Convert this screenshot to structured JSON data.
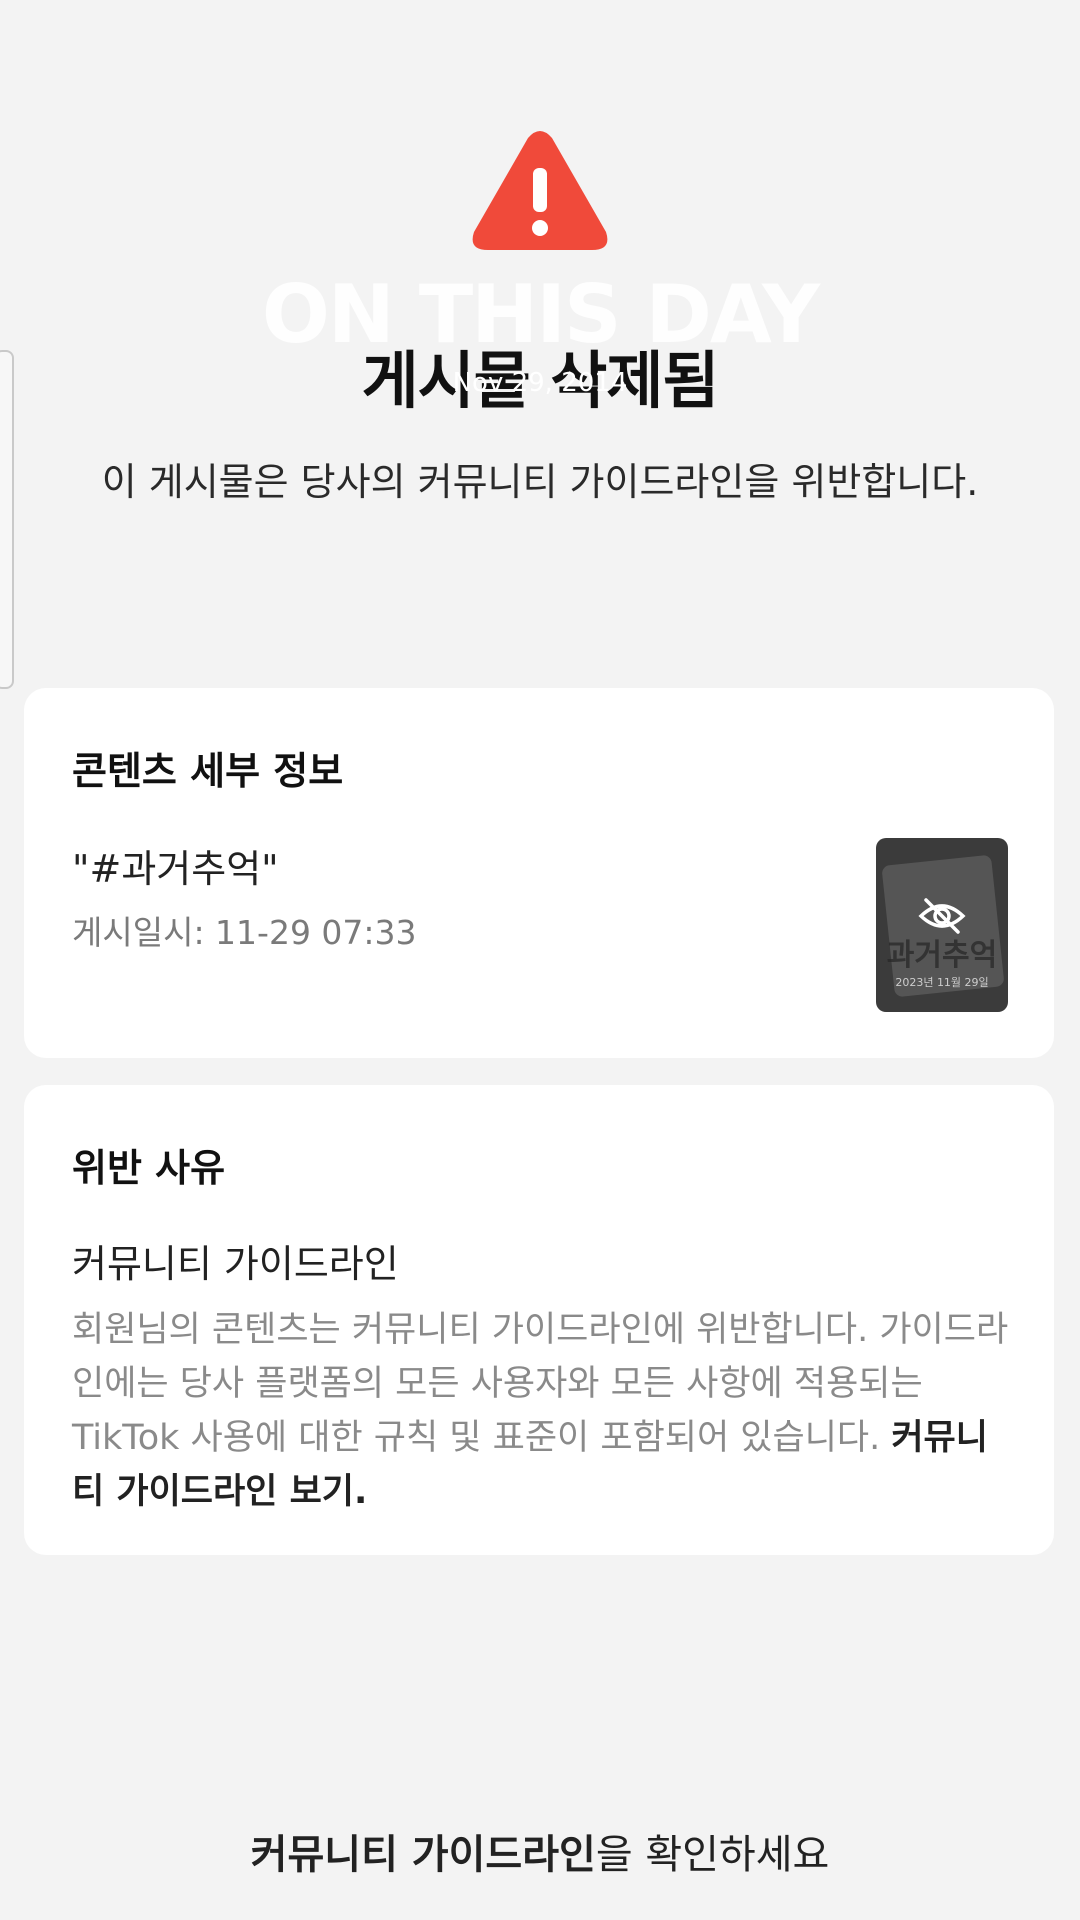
{
  "overlay": {
    "title": "ON THIS DAY",
    "date": "Nov 29, 2014"
  },
  "header": {
    "icon": "warning-triangle-icon",
    "title": "게시물 삭제됨",
    "subtitle": "이 게시물은 당사의 커뮤니티 가이드라인을 위반합니다."
  },
  "details_card": {
    "heading": "콘텐츠 세부 정보",
    "caption": "\"#과거추억\"",
    "posted_at": "게시일시: 11-29 07:33",
    "thumbnail": {
      "text": "과거추억",
      "subtext": "2023년 11월 29일",
      "icon": "eye-slash-icon"
    }
  },
  "reason_card": {
    "heading": "위반 사유",
    "category": "커뮤니티 가이드라인",
    "description": "회원님의 콘텐츠는 커뮤니티 가이드라인에 위반합니다. 가이드라인에는 당사 플랫폼의 모든 사용자와 모든 사항에 적용되는 TikTok 사용에 대한 규칙 및 표준이 포함되어 있습니다. ",
    "link_label": "커뮤니티 가이드라인 보기."
  },
  "footer": {
    "emphasis": "커뮤니티 가이드라인",
    "rest": "을 확인하세요"
  },
  "colors": {
    "warning": "#f04a3a",
    "background": "#f3f3f3",
    "card": "#ffffff"
  }
}
